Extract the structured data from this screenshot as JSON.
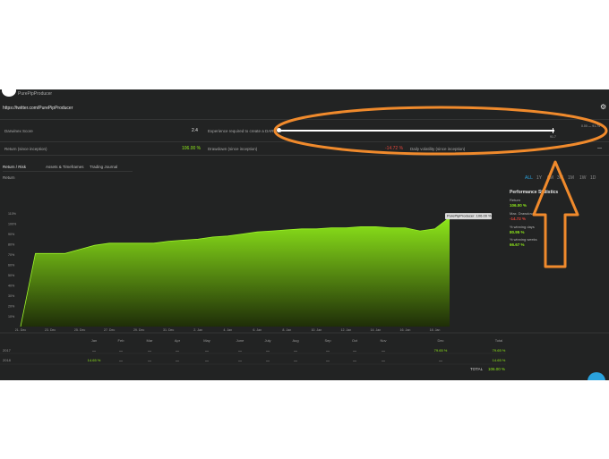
{
  "profile": {
    "username": "PurePipProducer",
    "url": "https://twitter.com/PurePipProducer"
  },
  "metrics": {
    "darwinex_score": {
      "label": "Darwinex Score",
      "value": "2.4"
    },
    "experience": {
      "label": "Experience required to create a DARWIN",
      "value_start": "",
      "value_mark": "91.7",
      "value_right": "0.00 — 91.74"
    },
    "return_since_inception": {
      "label": "Return (since inception)",
      "value": "106.00 %"
    },
    "drawdown_since_inception": {
      "label": "Drawdown (since inception)",
      "value": "-14.72 %"
    },
    "daily_volatility": {
      "label": "Daily volatility (since inception)",
      "value": "—"
    }
  },
  "tabs": [
    "Return / Risk",
    "Assets & Timeframes",
    "Trading Journal"
  ],
  "periods": [
    "ALL",
    "1Y",
    "6M",
    "3M",
    "1M",
    "1W",
    "1D"
  ],
  "active_period": "ALL",
  "chart_data": {
    "type": "area",
    "title": "Return",
    "tooltip": "PurePipProducer: 106.00 %",
    "x": [
      "21 Dec",
      "22 Dec",
      "23 Dec",
      "24 Dec",
      "25 Dec",
      "26 Dec",
      "27 Dec",
      "28 Dec",
      "29 Dec",
      "30 Dec",
      "31 Dec",
      "1 Jan",
      "2 Jan",
      "3 Jan",
      "4 Jan",
      "5 Jan",
      "6 Jan",
      "7 Jan",
      "8 Jan",
      "9 Jan",
      "10 Jan",
      "11 Jan",
      "12 Jan",
      "13 Jan",
      "14 Jan",
      "15 Jan",
      "16 Jan",
      "17 Jan",
      "18 Jan",
      "19 Jan"
    ],
    "y": [
      0,
      71,
      71,
      71,
      75,
      79,
      81,
      81,
      81,
      81,
      83,
      84,
      85,
      87,
      88,
      90,
      92,
      93,
      94,
      95,
      95,
      96,
      96,
      97,
      97,
      96,
      96,
      93,
      95,
      106
    ],
    "x_tick_labels": [
      "21. Dec",
      "23. Dec",
      "25. Dec",
      "27. Dec",
      "29. Dec",
      "31. Dec",
      "2. Jan",
      "4. Jan",
      "6. Jan",
      "8. Jan",
      "10. Jan",
      "12. Jan",
      "14. Jan",
      "16. Jan",
      "18. Jan"
    ],
    "y_ticks": [
      10,
      20,
      30,
      40,
      50,
      60,
      70,
      80,
      90,
      100,
      110
    ],
    "y_tick_labels": [
      "10%",
      "20%",
      "30%",
      "40%",
      "50%",
      "60%",
      "70%",
      "80%",
      "90%",
      "100%",
      "110%"
    ],
    "ylim": [
      0,
      120
    ],
    "series_color": "#8ee81a",
    "grid": false
  },
  "performance": {
    "title": "Performance Statistics",
    "items": [
      {
        "label": "Return",
        "value": "106.00 %",
        "color": "#8ee81a"
      },
      {
        "label": "Max. Drawdown",
        "value": "-14.72 %",
        "color": "#e0453a"
      },
      {
        "label": "% winning days",
        "value": "80.95 %",
        "color": "#8ee81a"
      },
      {
        "label": "% winning weeks",
        "value": "66.67 %",
        "color": "#8ee81a"
      }
    ]
  },
  "monthly_table": {
    "headers": [
      "Jan",
      "Feb",
      "Mar",
      "Apr",
      "May",
      "June",
      "July",
      "Aug",
      "Sep",
      "Oct",
      "Nov",
      "Dec",
      "Total"
    ],
    "rows": [
      {
        "year": "2017",
        "values": [
          "—",
          "—",
          "—",
          "—",
          "—",
          "—",
          "—",
          "—",
          "—",
          "—",
          "—",
          "79.65 %",
          "79.65 %"
        ]
      },
      {
        "year": "2018",
        "values": [
          "14.65 %",
          "—",
          "—",
          "—",
          "—",
          "—",
          "—",
          "—",
          "—",
          "—",
          "—",
          "—",
          "14.65 %"
        ]
      }
    ],
    "total_label": "TOTAL",
    "total_value": "106.00 %"
  },
  "annotation": {
    "color": "#f08a2c"
  }
}
